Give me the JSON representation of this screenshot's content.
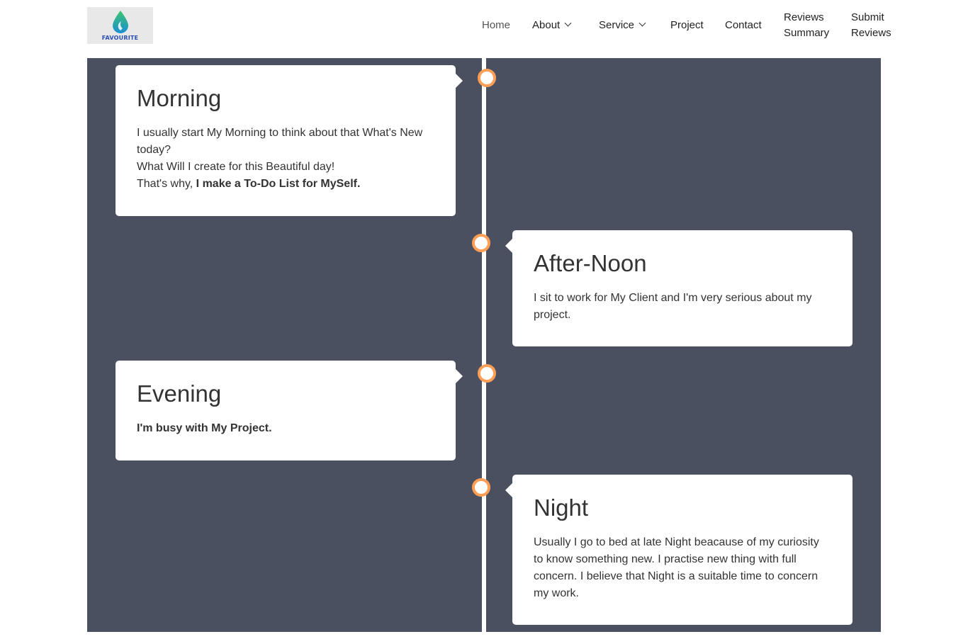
{
  "logo": {
    "text": "FAVOURITE"
  },
  "nav": {
    "home": "Home",
    "about": "About",
    "service": "Service",
    "project": "Project",
    "contact": "Contact",
    "reviews_summary_line1": "Reviews",
    "reviews_summary_line2": "Summary",
    "submit_reviews_line1": "Submit",
    "submit_reviews_line2": "Reviews"
  },
  "colors": {
    "timeline_bg": "#4a5060",
    "dot_ring": "#ff9f55",
    "card_bg": "#ffffff"
  },
  "timeline": [
    {
      "title": "Morning",
      "line1": "I usually start My Morning to think about that What's New today?",
      "line2": "What Will I create for this Beautiful day!",
      "line3_plain": "That's why, ",
      "line3_bold": "I make a To-Do List for MySelf."
    },
    {
      "title": "After-Noon",
      "text": "I sit to work for My Client and I'm very serious about my project."
    },
    {
      "title": "Evening",
      "text_bold": "I'm busy with My Project."
    },
    {
      "title": "Night",
      "text": "Usually I go to bed at late Night beacause of my curiosity to know something new. I practise new thing with full concern. I believe that Night is a suitable time to concern my work."
    }
  ]
}
